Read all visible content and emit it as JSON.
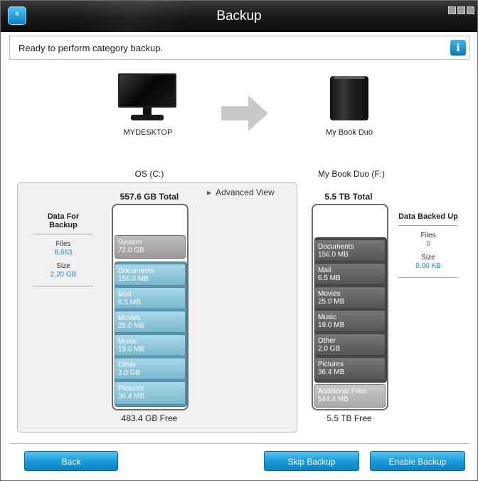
{
  "window": {
    "title": "Backup"
  },
  "status": {
    "message": "Ready to perform category backup."
  },
  "source": {
    "device_name": "MYDESKTOP",
    "volume": "OS (C:)",
    "total": "557.6 GB Total",
    "free": "483.4 GB Free",
    "segments": [
      {
        "name": "System",
        "size": "72.0 GB"
      },
      {
        "name": "Documents",
        "size": "156.0 MB"
      },
      {
        "name": "Mail",
        "size": "6.5 MB"
      },
      {
        "name": "Movies",
        "size": "25.0 MB"
      },
      {
        "name": "Music",
        "size": "19.0 MB"
      },
      {
        "name": "Other",
        "size": "2.0 GB"
      },
      {
        "name": "Pictures",
        "size": "36.4 MB"
      }
    ]
  },
  "destination": {
    "device_name": "My Book Duo",
    "volume": "My Book Duo (F:)",
    "total": "5.5 TB Total",
    "free": "5.5 TB Free",
    "segments": [
      {
        "name": "Documents",
        "size": "156.0 MB"
      },
      {
        "name": "Mail",
        "size": "6.5 MB"
      },
      {
        "name": "Movies",
        "size": "25.0 MB"
      },
      {
        "name": "Music",
        "size": "19.0 MB"
      },
      {
        "name": "Other",
        "size": "2.0 GB"
      },
      {
        "name": "Pictures",
        "size": "36.4 MB"
      },
      {
        "name": "Additional Files",
        "size": "544.4 MB"
      }
    ]
  },
  "advanced_view": {
    "label": "Advanced View"
  },
  "data_for_backup": {
    "heading": "Data For Backup",
    "files_label": "Files",
    "files": "8,663",
    "size_label": "Size",
    "size": "2.20 GB"
  },
  "data_backed_up": {
    "heading": "Data Backed Up",
    "files_label": "Files",
    "files": "0",
    "size_label": "Size",
    "size": "0.00 KB"
  },
  "buttons": {
    "back": "Back",
    "skip": "Skip Backup",
    "enable": "Enable Backup"
  },
  "colors": {
    "accent": "#1c9ad9",
    "value_text": "#1a8ad0",
    "titlebar": "#161616"
  }
}
